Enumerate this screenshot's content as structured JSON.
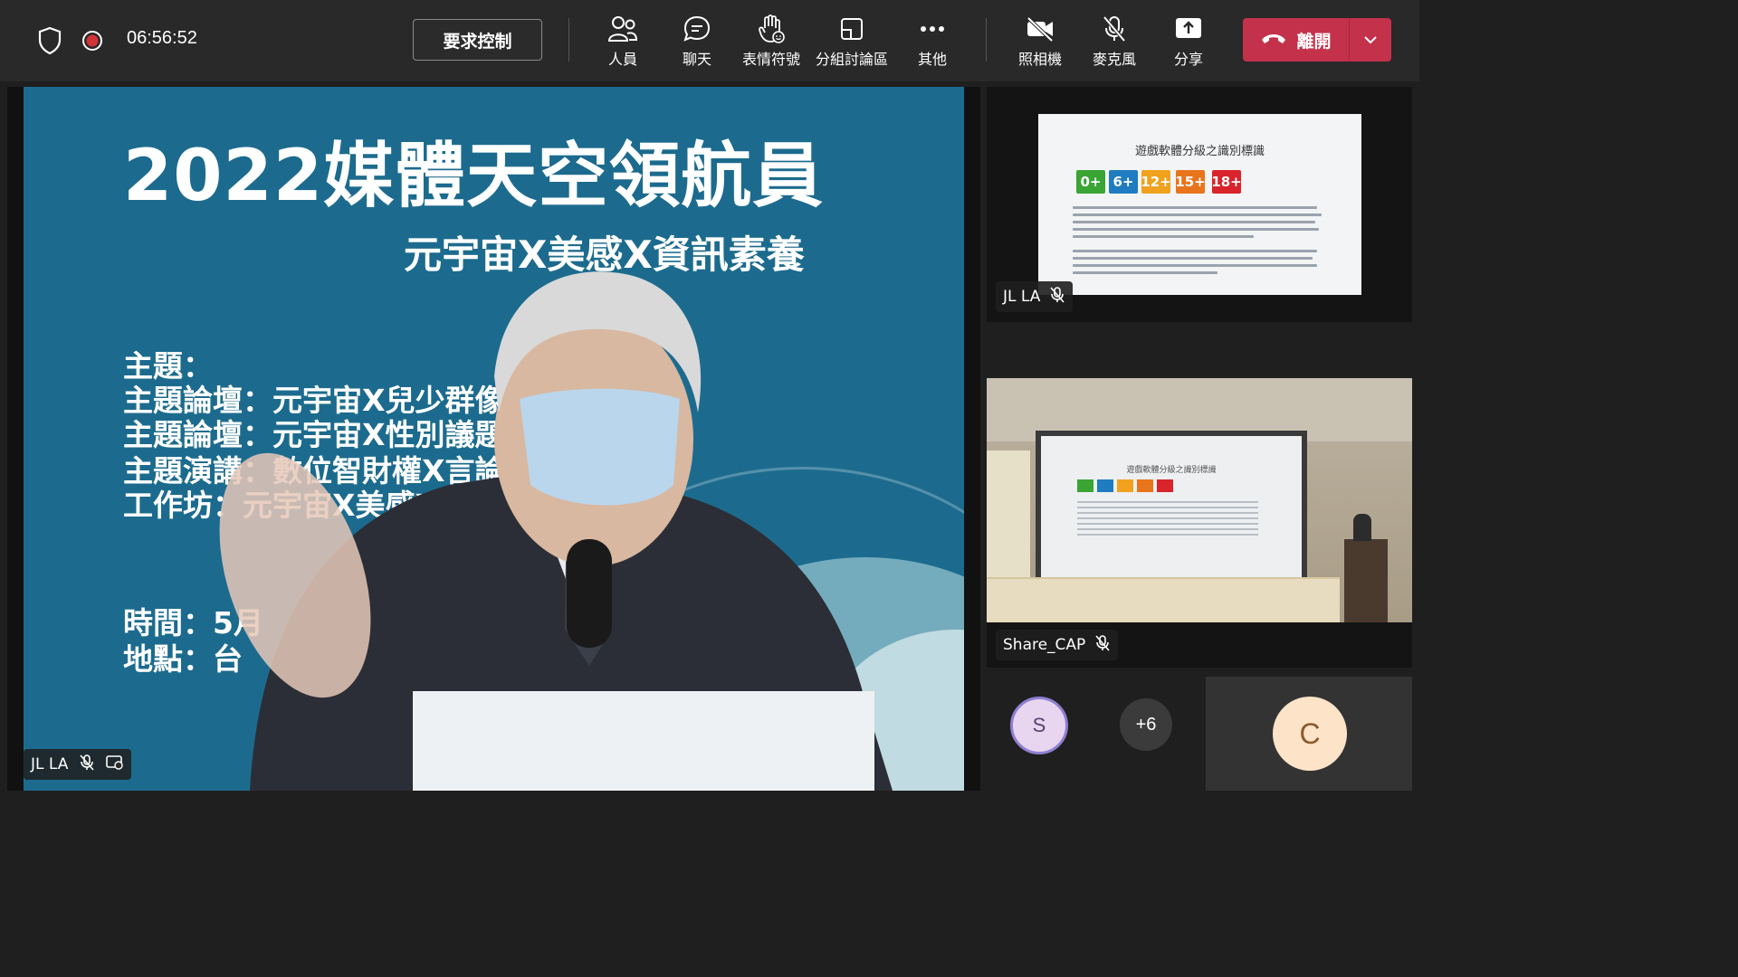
{
  "toolbar": {
    "timer": "06:56:52",
    "request_control": "要求控制",
    "people": "人員",
    "chat": "聊天",
    "reactions": "表情符號",
    "breakout": "分組討論區",
    "more": "其他",
    "camera": "照相機",
    "mic": "麥克風",
    "share": "分享",
    "leave": "離開"
  },
  "main_stage": {
    "slide_title": "2022媒體天空領航員",
    "slide_subtitle": "元宇宙X美感X資訊素養",
    "slide_lines": [
      "主題：",
      "主題論壇：元宇宙X兒少群像",
      "主題論壇：元宇宙X性別議題",
      "主題演講：數位智財權X言論自由",
      "工作坊：元宇宙X美感X在地創生",
      "時間：5月",
      "地點：台"
    ],
    "participant_name": "JL LA"
  },
  "tiles": {
    "shared_slide": {
      "participant_name": "JL LA",
      "title": "遊戲軟體分級之識別標識",
      "ratings": [
        "0+",
        "6+",
        "12+",
        "15+",
        "18+"
      ],
      "rating_colors": [
        "#3aa435",
        "#1f7cc0",
        "#f0a21e",
        "#e8741c",
        "#d8242a"
      ]
    },
    "room_cam": {
      "participant_name": "Share_CAP",
      "screen_title": "遊戲軟體分級之識別標識"
    },
    "overflow": {
      "avatar_s": "S",
      "more_count": "+6",
      "avatar_c": "C"
    }
  },
  "colors": {
    "leave_red": "#c4314b",
    "topbar": "#292929",
    "slide_blue": "#1c6b8e"
  }
}
